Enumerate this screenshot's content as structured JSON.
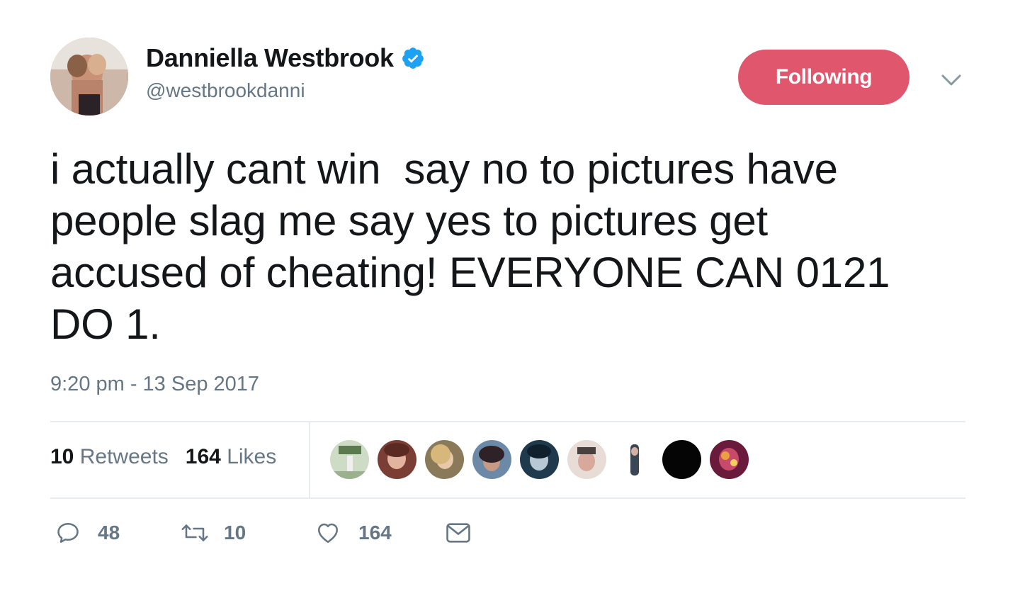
{
  "author": {
    "display_name": "Danniella Westbrook",
    "handle": "@westbrookdanni",
    "verified": true
  },
  "follow_button": {
    "label": "Following",
    "color": "#e0566d"
  },
  "tweet": {
    "text": "i actually cant win  say no to pictures have\npeople slag me say yes to pictures get\naccused of cheating! EVERYONE CAN 0121\nDO 1.",
    "timestamp": "9:20 pm - 13 Sep 2017"
  },
  "stats": {
    "retweets_count": "10",
    "retweets_label": "Retweets",
    "likes_count": "164",
    "likes_label": "Likes"
  },
  "likers": [
    {
      "icon": "liker-avatar-1",
      "color": "#c9d6bf"
    },
    {
      "icon": "liker-avatar-2",
      "color": "#9a5a4e"
    },
    {
      "icon": "liker-avatar-3",
      "color": "#b99a7a"
    },
    {
      "icon": "liker-avatar-4",
      "color": "#4a3a40"
    },
    {
      "icon": "liker-avatar-5",
      "color": "#2f4a5c"
    },
    {
      "icon": "liker-avatar-6",
      "color": "#d9c8c0"
    },
    {
      "icon": "liker-avatar-7",
      "color": "#e8e8e8"
    },
    {
      "icon": "liker-avatar-8",
      "color": "#050505"
    },
    {
      "icon": "liker-avatar-9",
      "color": "#8a2a4a"
    }
  ],
  "actions": {
    "reply_count": "48",
    "retweet_count": "10",
    "like_count": "164"
  }
}
